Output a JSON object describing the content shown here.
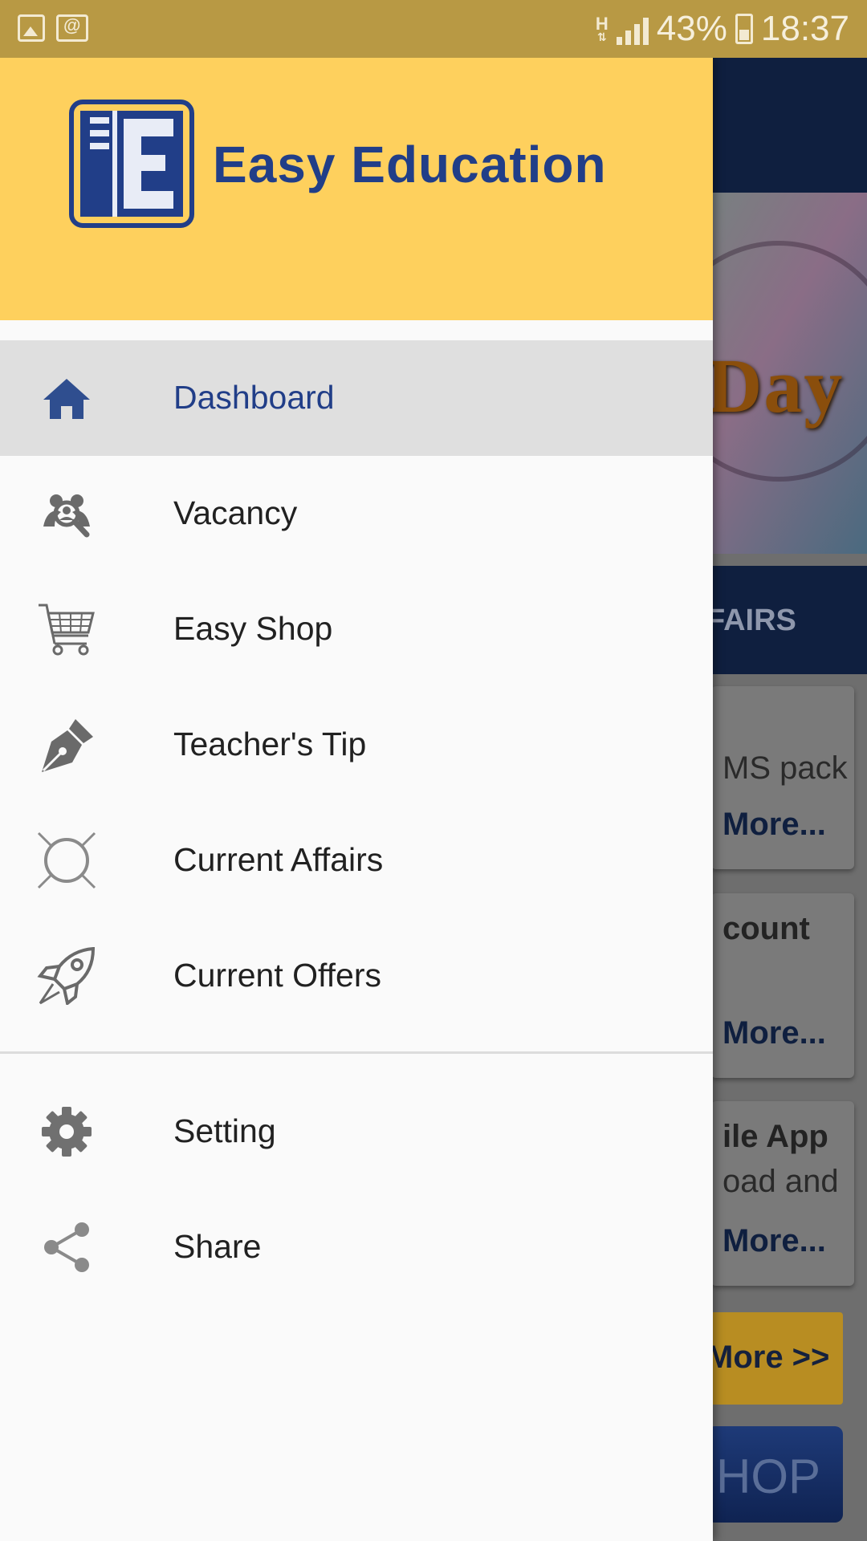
{
  "status_bar": {
    "network_type": "H",
    "battery_percent": "43%",
    "time": "18:37",
    "notification_icons": [
      "image-notification-icon",
      "email-notification-icon"
    ]
  },
  "drawer": {
    "brand_name": "Easy Education",
    "logo_letter": "E",
    "header_color": "#fed05d",
    "brand_color": "#213e88",
    "menu_items": [
      {
        "label": "Dashboard",
        "icon": "home-icon",
        "active": true
      },
      {
        "label": "Vacancy",
        "icon": "people-search-icon",
        "active": false
      },
      {
        "label": "Easy Shop",
        "icon": "shopping-cart-icon",
        "active": false
      },
      {
        "label": "Teacher's Tip",
        "icon": "pen-nib-icon",
        "active": false
      },
      {
        "label": "Current Affairs",
        "icon": "globe-icon",
        "active": false
      },
      {
        "label": "Current Offers",
        "icon": "rocket-icon",
        "active": false
      }
    ],
    "secondary_items": [
      {
        "label": "Setting",
        "icon": "gear-icon"
      },
      {
        "label": "Share",
        "icon": "share-icon"
      }
    ]
  },
  "background": {
    "banner_text": "Day",
    "tab_label": "FAIRS",
    "cards": [
      {
        "line1": "MS pack",
        "more": "More..."
      },
      {
        "line1": "count",
        "more": "More..."
      },
      {
        "line1": "ile App",
        "line2": "oad and",
        "more": "More..."
      }
    ],
    "more_button": "More >>",
    "shop_button": "HOP"
  }
}
